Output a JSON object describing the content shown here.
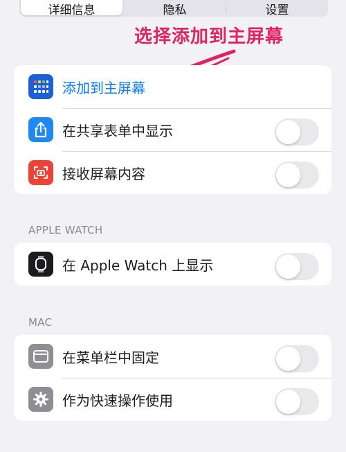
{
  "tabs": [
    {
      "label": "详细信息",
      "active": true
    },
    {
      "label": "隐私",
      "active": false
    },
    {
      "label": "设置",
      "active": false
    }
  ],
  "annotation": {
    "text": "选择添加到主屏幕",
    "color": "#e0245e"
  },
  "group1": {
    "rows": [
      {
        "label": "添加到主屏幕",
        "icon": "home-screen-grid-icon",
        "color": "#1d5fd6",
        "is_link": true
      },
      {
        "label": "在共享表单中显示",
        "icon": "share-icon",
        "color": "#1e88f5",
        "toggle": false
      },
      {
        "label": "接收屏幕内容",
        "icon": "screenshot-camera-icon",
        "color": "#ef4236",
        "toggle": false
      }
    ]
  },
  "apple_watch": {
    "header": "APPLE WATCH",
    "rows": [
      {
        "label": "在 Apple Watch 上显示",
        "icon": "apple-watch-icon",
        "color": "#1c1c1e",
        "toggle": false
      }
    ]
  },
  "mac": {
    "header": "MAC",
    "rows": [
      {
        "label": "在菜单栏中固定",
        "icon": "menu-bar-icon",
        "color": "#8e8e93",
        "toggle": false
      },
      {
        "label": "作为快速操作使用",
        "icon": "gear-icon",
        "color": "#8e8e93",
        "toggle": false
      }
    ]
  }
}
